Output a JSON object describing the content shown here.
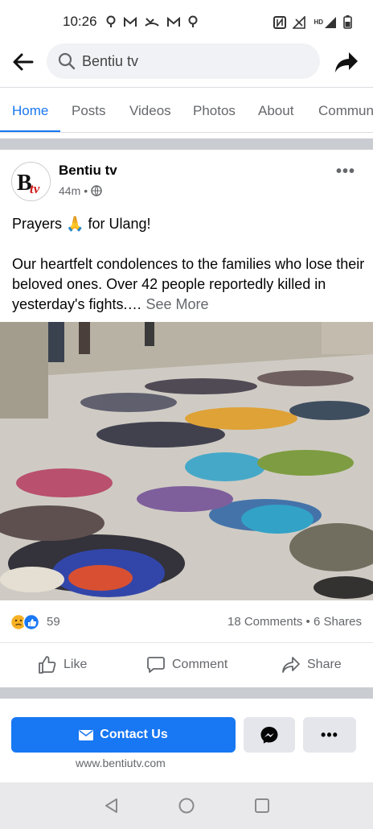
{
  "status_bar": {
    "time": "10:26",
    "left_icons": [
      "location-icon",
      "gmail-icon",
      "missed-call-icon",
      "gmail-icon",
      "location-icon"
    ],
    "right_icons": [
      "nfc-icon",
      "signal-off-icon",
      "hd-signal-icon",
      "battery-icon"
    ],
    "hd_label": "HD"
  },
  "header": {
    "search_value": "Bentiu tv"
  },
  "tabs": [
    {
      "label": "Home",
      "active": true
    },
    {
      "label": "Posts"
    },
    {
      "label": "Videos"
    },
    {
      "label": "Photos"
    },
    {
      "label": "About"
    },
    {
      "label": "Commun"
    }
  ],
  "post": {
    "page_name": "Bentiu tv",
    "time": "44m",
    "separator": "•",
    "avatar_text": "Btv",
    "line1_before": "Prayers",
    "line1_emoji": "🙏",
    "line1_after": "for Ulang!",
    "body": "Our heartfelt condolences to the families who lose their beloved ones. Over 42 people reportedly killed in yesterday's fights.…",
    "see_more": "See More",
    "reaction_count": "59",
    "comments_shares": "18 Comments • 6 Shares",
    "actions": {
      "like": "Like",
      "comment": "Comment",
      "share": "Share"
    }
  },
  "page_card": {
    "contact_label": "Contact Us",
    "more_label": "•••",
    "website": "www.bentiutv.com"
  },
  "colors": {
    "accent": "#1877f2",
    "secondary_text": "#65676b",
    "divider": "#c9ccd1"
  }
}
